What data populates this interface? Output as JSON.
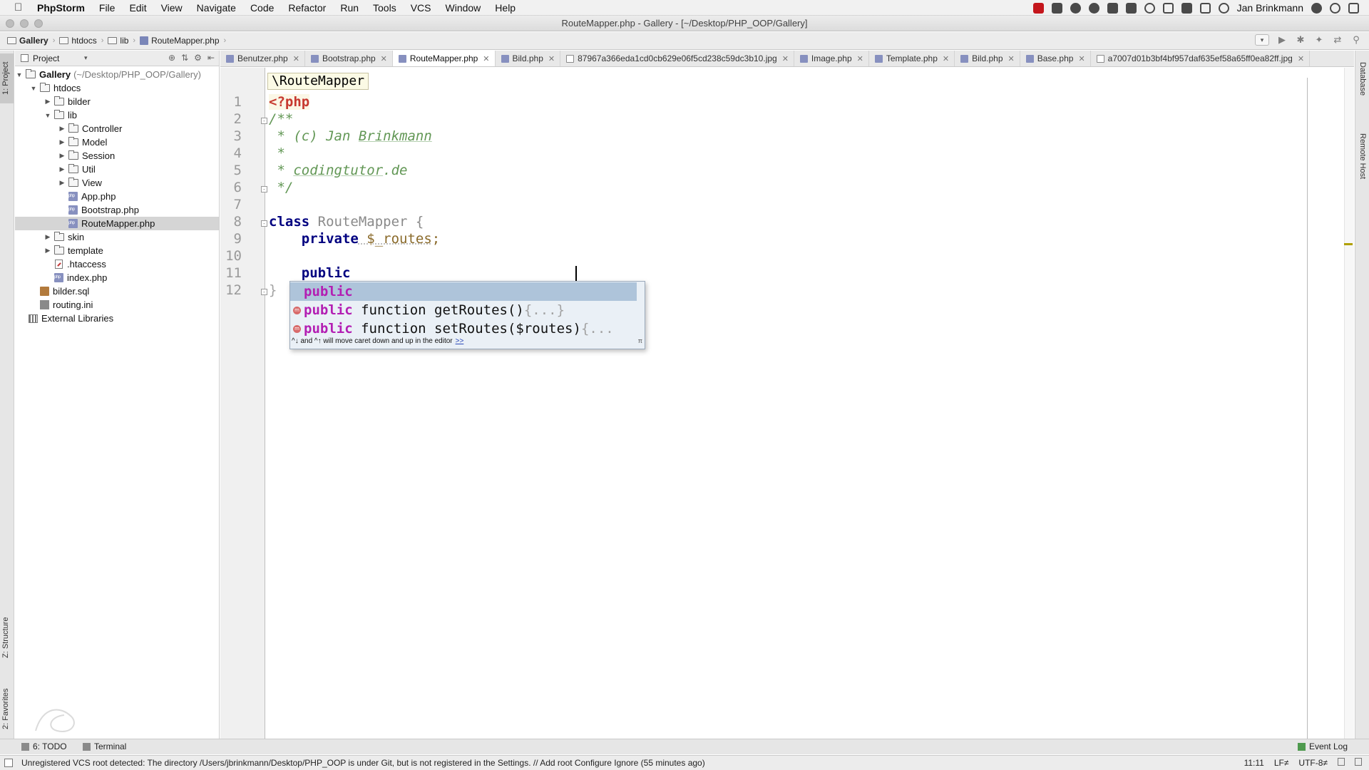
{
  "menubar": {
    "app": "PhpStorm",
    "items": [
      "File",
      "Edit",
      "View",
      "Navigate",
      "Code",
      "Refactor",
      "Run",
      "Tools",
      "VCS",
      "Window",
      "Help"
    ],
    "user": "Jan Brinkmann"
  },
  "window": {
    "title": "RouteMapper.php - Gallery - [~/Desktop/PHP_OOP/Gallery]"
  },
  "navbar": {
    "crumbs": [
      "Gallery",
      "htdocs",
      "lib",
      "RouteMapper.php"
    ]
  },
  "left_strip": {
    "project_label": "1: Project",
    "structure_label": "Z: Structure",
    "favorites_label": "2: Favorites"
  },
  "right_strip": {
    "database_label": "Database",
    "remote_label": "Remote Host"
  },
  "project": {
    "header": "Project",
    "root": "Gallery",
    "root_path": "(~/Desktop/PHP_OOP/Gallery)",
    "tree": [
      {
        "label": "htdocs"
      },
      {
        "label": "bilder"
      },
      {
        "label": "lib"
      },
      {
        "label": "Controller"
      },
      {
        "label": "Model"
      },
      {
        "label": "Session"
      },
      {
        "label": "Util"
      },
      {
        "label": "View"
      },
      {
        "label": "App.php"
      },
      {
        "label": "Bootstrap.php"
      },
      {
        "label": "RouteMapper.php"
      },
      {
        "label": "skin"
      },
      {
        "label": "template"
      },
      {
        "label": ".htaccess"
      },
      {
        "label": "index.php"
      },
      {
        "label": "bilder.sql"
      },
      {
        "label": "routing.ini"
      },
      {
        "label": "External Libraries"
      }
    ]
  },
  "tabs": [
    "Benutzer.php",
    "Bootstrap.php",
    "RouteMapper.php",
    "Bild.php",
    "87967a366eda1cd0cb629e06f5cd238c59dc3b10.jpg",
    "Image.php",
    "Template.php",
    "Bild.php",
    "Base.php",
    "a7007d01b3bf4bf957daf635ef58a65ff0ea82ff.jpg"
  ],
  "editor": {
    "breadcrumb": "\\RouteMapper",
    "line_numbers": [
      "1",
      "2",
      "3",
      "4",
      "5",
      "6",
      "7",
      "8",
      "9",
      "10",
      "11",
      "12"
    ],
    "code": {
      "l1": "<?php",
      "l2": "/**",
      "l3_prefix": " * (c) Jan ",
      "l3_name": "Brinkmann",
      "l4": " *",
      "l5_prefix": " * ",
      "l5_site": "codingtutor",
      "l5_suffix": ".de",
      "l6": " */",
      "l8_kw": "class",
      "l8_name": " RouteMapper {",
      "l9_kw": "    private",
      "l9_var": " $_routes",
      "l9_end": ";",
      "l11": "    public",
      "l12": "}"
    }
  },
  "completion": {
    "items": [
      {
        "match": "public",
        "rest": "",
        "tail": ""
      },
      {
        "match": "public",
        "rest": " function getRoutes()",
        "tail": "{...}"
      },
      {
        "match": "public",
        "rest": " function setRoutes($routes)",
        "tail": "{..."
      }
    ],
    "icon_letter": "m",
    "hint": "^↓ and ^↑ will move caret down and up in the editor",
    "hint_link": ">>",
    "pin": "π"
  },
  "bottom": {
    "todo": "6: TODO",
    "terminal": "Terminal",
    "event_log": "Event Log"
  },
  "status": {
    "message": "Unregistered VCS root detected: The directory /Users/jbrinkmann/Desktop/PHP_OOP is under Git, but is not registered in the Settings. // Add root  Configure  Ignore (55 minutes ago)",
    "position": "11:11",
    "line_sep": "LF≠",
    "encoding": "UTF-8≠"
  }
}
